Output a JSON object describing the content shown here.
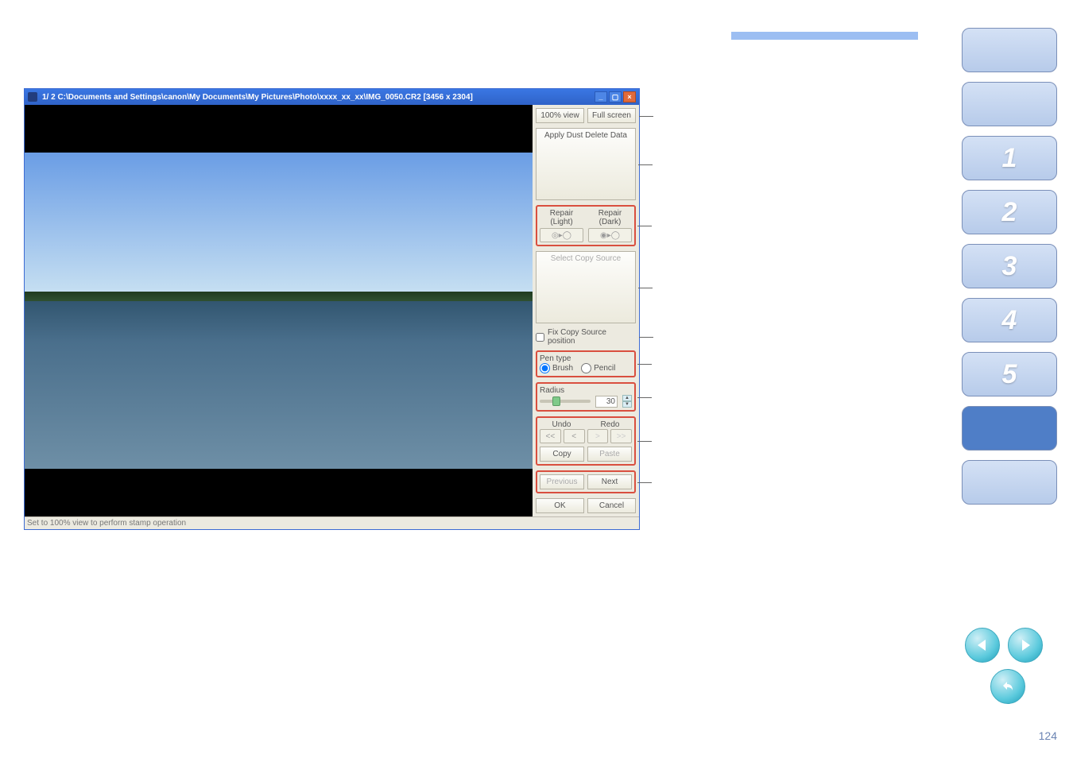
{
  "doc": {
    "page_number": "124"
  },
  "topbar": {},
  "sidebar": {
    "items": [
      {
        "label": ""
      },
      {
        "label": ""
      },
      {
        "label": "1"
      },
      {
        "label": "2"
      },
      {
        "label": "3"
      },
      {
        "label": "4"
      },
      {
        "label": "5"
      },
      {
        "label": ""
      },
      {
        "label": ""
      }
    ]
  },
  "round_nav": {
    "prev": "prev",
    "next": "next",
    "back": "back"
  },
  "win": {
    "title": "1/  2  C:\\Documents and Settings\\canon\\My Documents\\My Pictures\\Photo\\xxxx_xx_xx\\IMG_0050.CR2 [3456 x 2304]",
    "btn_min": "_",
    "btn_max": "▢",
    "btn_close": "×",
    "statusbar": "Set to 100% view to perform stamp operation"
  },
  "panel": {
    "view_100": "100% view",
    "full_screen": "Full screen",
    "apply_dust": "Apply Dust Delete Data",
    "repair_light": "Repair\n(Light)",
    "repair_dark": "Repair\n(Dark)",
    "select_copy_source": "Select Copy Source",
    "fix_copy_source": "Fix Copy Source position",
    "pen_type_label": "Pen type",
    "pen_brush": "Brush",
    "pen_pencil": "Pencil",
    "radius_label": "Radius",
    "radius_value": "30",
    "undo_label": "Undo",
    "redo_label": "Redo",
    "undo_all": "<<",
    "undo_one": "<",
    "redo_one": ">",
    "redo_all": ">>",
    "copy": "Copy",
    "paste": "Paste",
    "previous": "Previous",
    "next": "Next",
    "ok": "OK",
    "cancel": "Cancel"
  }
}
